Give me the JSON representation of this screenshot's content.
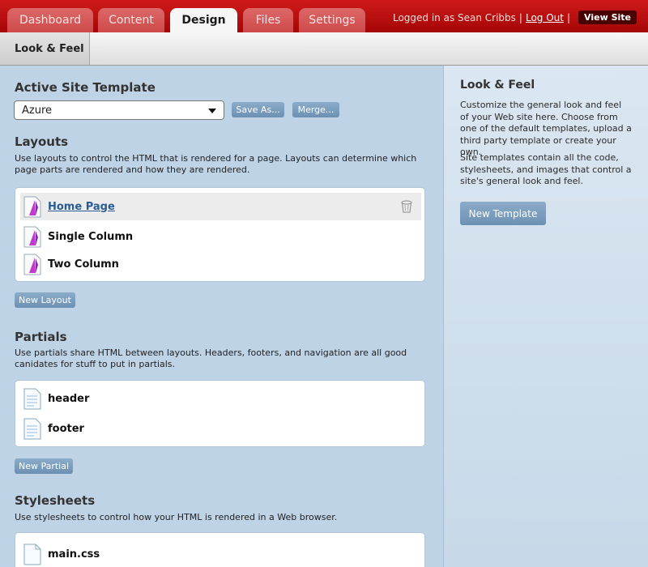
{
  "nav": {
    "tabs": [
      {
        "label": "Dashboard"
      },
      {
        "label": "Content"
      },
      {
        "label": "Design"
      },
      {
        "label": "Files"
      },
      {
        "label": "Settings"
      }
    ],
    "active_tab": "Design",
    "login_text": "Logged in as Sean Cribbs",
    "separator": "|",
    "logout_label": "Log Out",
    "view_site_label": "View Site"
  },
  "subnav": {
    "active": "Look & Feel"
  },
  "template": {
    "heading": "Active Site Template",
    "selected": "Azure",
    "save_as_label": "Save As...",
    "merge_label": "Merge..."
  },
  "layouts": {
    "heading": "Layouts",
    "description": "Use layouts to control the HTML that is rendered for a page. Layouts can determine which page parts are rendered and how they are rendered.",
    "items": [
      {
        "label": "Home Page"
      },
      {
        "label": "Single Column"
      },
      {
        "label": "Two Column"
      }
    ],
    "new_label": "New Layout"
  },
  "partials": {
    "heading": "Partials",
    "description": "Use partials share HTML between layouts. Headers, footers, and navigation are all good canidates for stuff to put in partials.",
    "items": [
      {
        "label": "header"
      },
      {
        "label": "footer"
      }
    ],
    "new_label": "New Partial"
  },
  "stylesheets": {
    "heading": "Stylesheets",
    "description": "Use stylesheets to control how your HTML is rendered in a Web browser.",
    "items": [
      {
        "label": "main.css"
      }
    ]
  },
  "sidebar": {
    "heading": "Look & Feel",
    "paragraph1": "Customize the general look and feel of your Web site here. Choose from one of the default templates, upload a third party template or create your own.",
    "paragraph2": "Site templates contain all the code, stylesheets, and images that control a site's general look and feel.",
    "new_template_label": "New Template"
  },
  "colors": {
    "header_red": "#b50d0d",
    "background": "#bfd3e6",
    "button_blue": "#7799bb",
    "link_blue": "#2a5b94"
  }
}
